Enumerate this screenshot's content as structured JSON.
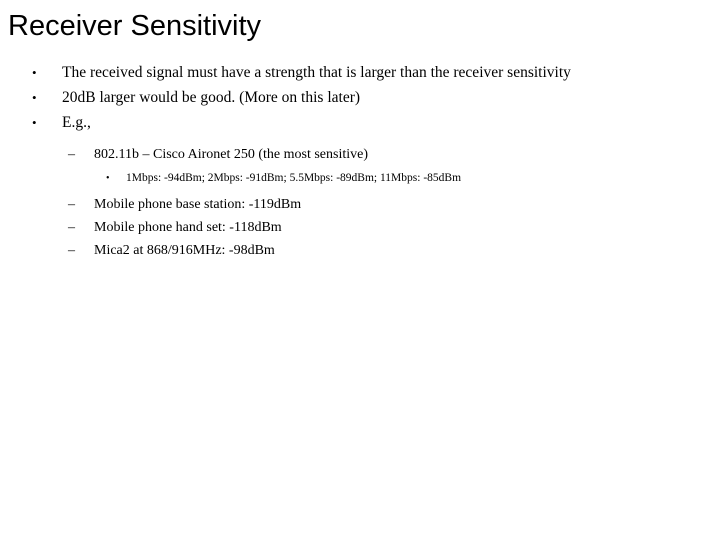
{
  "slide": {
    "title": "Receiver Sensitivity",
    "background_color": "#ffffff",
    "text_color": "#000000",
    "markers": {
      "level1": "•",
      "level2": "–",
      "level3": "•"
    },
    "content": [
      {
        "level": 1,
        "text": "The received signal must have a strength that is larger than the receiver sensitivity"
      },
      {
        "level": 1,
        "text": "20dB larger would be good. (More on this later)"
      },
      {
        "level": 1,
        "text": "E.g.,"
      },
      {
        "level": 2,
        "text": "802.11b – Cisco Aironet 250 (the most sensitive)"
      },
      {
        "level": 3,
        "text": "1Mbps: -94dBm; 2Mbps: -91dBm; 5.5Mbps: -89dBm; 11Mbps: -85dBm"
      },
      {
        "level": 2,
        "text": "Mobile phone base station: -119dBm"
      },
      {
        "level": 2,
        "text": "Mobile phone hand set: -118dBm"
      },
      {
        "level": 2,
        "text": "Mica2 at 868/916MHz: -98dBm"
      }
    ]
  }
}
